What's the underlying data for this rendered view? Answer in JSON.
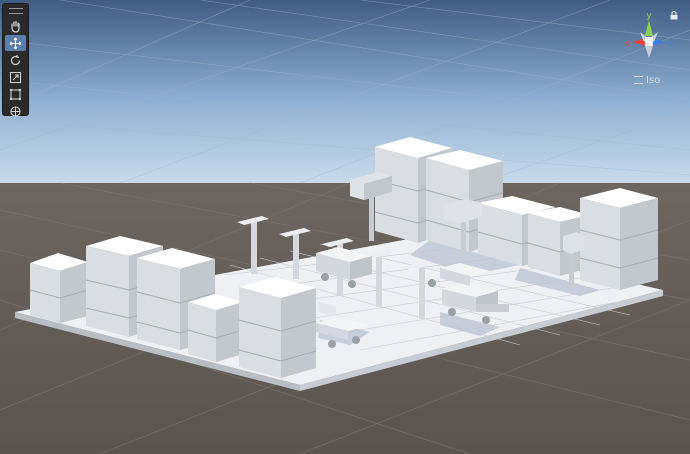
{
  "scene": {
    "camera_mode_label": "Iso"
  },
  "toolbar": {
    "tools": [
      {
        "name": "hand-tool",
        "icon": "hand-icon",
        "active": false
      },
      {
        "name": "move-tool",
        "icon": "move-icon",
        "active": true
      },
      {
        "name": "rotate-tool",
        "icon": "rotate-icon",
        "active": false
      },
      {
        "name": "scale-tool",
        "icon": "scale-icon",
        "active": false
      },
      {
        "name": "rect-tool",
        "icon": "rect-icon",
        "active": false
      },
      {
        "name": "transform-tool",
        "icon": "transform-icon",
        "active": false
      }
    ]
  },
  "gizmo": {
    "axis_y": "y",
    "axis_x": "x",
    "axis_z": "z",
    "colors": {
      "x": "#e8453c",
      "y": "#8fd14f",
      "z": "#3f7fe0"
    }
  },
  "colors": {
    "sky_top": "#3e5c86",
    "sky_horizon": "#c3d7e9",
    "ground": "#5f5a56",
    "toolbar_bg": "#2a2a2a",
    "tool_active": "#5a7faf"
  }
}
